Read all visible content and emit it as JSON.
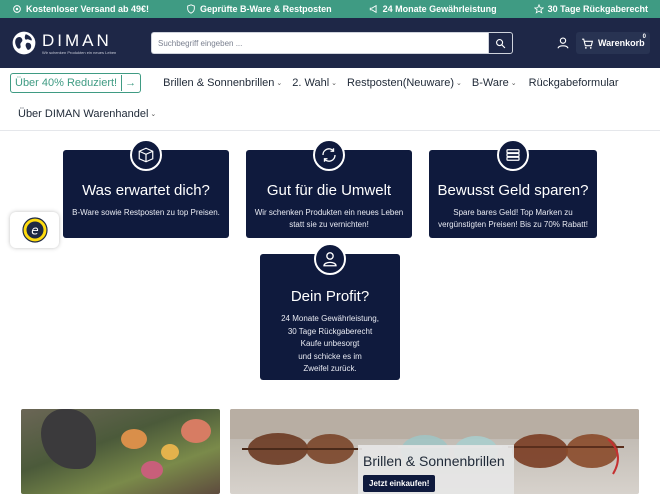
{
  "topbar": {
    "usps": [
      {
        "icon": "gear-icon",
        "label": "Kostenloser Versand ab 49€!"
      },
      {
        "icon": "shield-icon",
        "label": "Geprüfte B-Ware & Restposten"
      },
      {
        "icon": "megaphone-icon",
        "label": "24 Monate Gewährleistung"
      },
      {
        "icon": "star-icon",
        "label": "30 Tage Rückgaberecht"
      }
    ],
    "color": "#3f9b83"
  },
  "header": {
    "brand": "DIMAN",
    "tagline": "Wir schenken Produkten ein neues Leben",
    "search_placeholder": "Suchbegriff eingeben ...",
    "cart_label": "Warenkorb",
    "cart_count": "0",
    "background": "#1e2747"
  },
  "nav": {
    "promo": "Über 40% Reduziert!",
    "promo_arrow": "→",
    "items": [
      {
        "label": "Brillen & Sonnenbrillen",
        "has_dropdown": true
      },
      {
        "label": "2. Wahl",
        "has_dropdown": true
      },
      {
        "label": "Restposten(Neuware)",
        "has_dropdown": true
      },
      {
        "label": "B-Ware",
        "has_dropdown": true
      },
      {
        "label": "Rückgabeformular",
        "has_dropdown": false
      }
    ],
    "row2": [
      {
        "label": "Über DIMAN Warenhandel",
        "has_dropdown": true
      }
    ],
    "chevron": "⌄"
  },
  "features": [
    {
      "icon": "box-icon",
      "title": "Was erwartet dich?",
      "text": "B-Ware sowie Restposten zu top Preisen."
    },
    {
      "icon": "recycle-icon",
      "title": "Gut für die Umwelt",
      "text": "Wir schenken Produkten ein neues Leben statt sie zu vernichten!"
    },
    {
      "icon": "money-stack-icon",
      "title": "Bewusst Geld sparen?",
      "text": "Spare bares Geld! Top Marken zu vergünstigten Preisen! Bis zu 70% Rabatt!"
    },
    {
      "icon": "user-icon",
      "title": "Dein Profit?",
      "lines": [
        "24 Monate Gewährleistung,",
        "30 Tage Rückgaberecht",
        "Kaufe unbesorgt",
        "und schicke es im",
        "Zweifel zurück."
      ]
    }
  ],
  "tiles": {
    "right_title": "Brillen & Sonnenbrillen",
    "right_button": "Jetzt einkaufen!"
  },
  "trust_badge": {
    "icon": "trusted-shops-icon",
    "letter": "e"
  }
}
